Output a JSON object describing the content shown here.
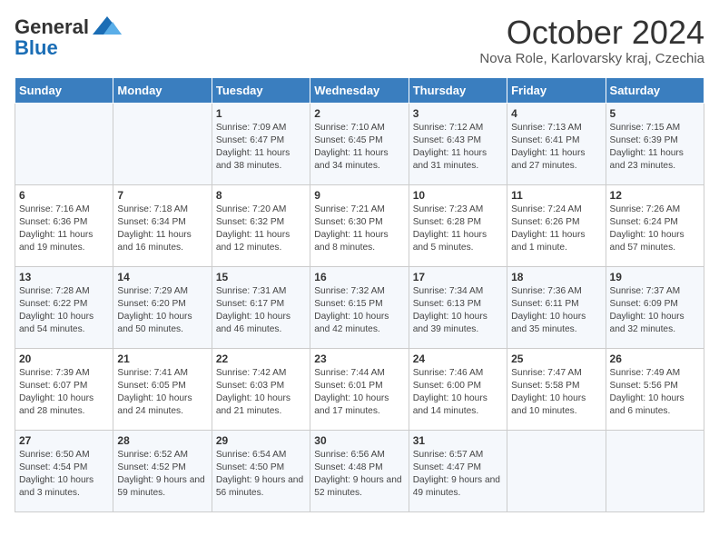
{
  "header": {
    "logo_general": "General",
    "logo_blue": "Blue",
    "month_title": "October 2024",
    "location": "Nova Role, Karlovarsky kraj, Czechia"
  },
  "weekdays": [
    "Sunday",
    "Monday",
    "Tuesday",
    "Wednesday",
    "Thursday",
    "Friday",
    "Saturday"
  ],
  "weeks": [
    [
      {
        "day": "",
        "content": ""
      },
      {
        "day": "",
        "content": ""
      },
      {
        "day": "1",
        "content": "Sunrise: 7:09 AM\nSunset: 6:47 PM\nDaylight: 11 hours and 38 minutes."
      },
      {
        "day": "2",
        "content": "Sunrise: 7:10 AM\nSunset: 6:45 PM\nDaylight: 11 hours and 34 minutes."
      },
      {
        "day": "3",
        "content": "Sunrise: 7:12 AM\nSunset: 6:43 PM\nDaylight: 11 hours and 31 minutes."
      },
      {
        "day": "4",
        "content": "Sunrise: 7:13 AM\nSunset: 6:41 PM\nDaylight: 11 hours and 27 minutes."
      },
      {
        "day": "5",
        "content": "Sunrise: 7:15 AM\nSunset: 6:39 PM\nDaylight: 11 hours and 23 minutes."
      }
    ],
    [
      {
        "day": "6",
        "content": "Sunrise: 7:16 AM\nSunset: 6:36 PM\nDaylight: 11 hours and 19 minutes."
      },
      {
        "day": "7",
        "content": "Sunrise: 7:18 AM\nSunset: 6:34 PM\nDaylight: 11 hours and 16 minutes."
      },
      {
        "day": "8",
        "content": "Sunrise: 7:20 AM\nSunset: 6:32 PM\nDaylight: 11 hours and 12 minutes."
      },
      {
        "day": "9",
        "content": "Sunrise: 7:21 AM\nSunset: 6:30 PM\nDaylight: 11 hours and 8 minutes."
      },
      {
        "day": "10",
        "content": "Sunrise: 7:23 AM\nSunset: 6:28 PM\nDaylight: 11 hours and 5 minutes."
      },
      {
        "day": "11",
        "content": "Sunrise: 7:24 AM\nSunset: 6:26 PM\nDaylight: 11 hours and 1 minute."
      },
      {
        "day": "12",
        "content": "Sunrise: 7:26 AM\nSunset: 6:24 PM\nDaylight: 10 hours and 57 minutes."
      }
    ],
    [
      {
        "day": "13",
        "content": "Sunrise: 7:28 AM\nSunset: 6:22 PM\nDaylight: 10 hours and 54 minutes."
      },
      {
        "day": "14",
        "content": "Sunrise: 7:29 AM\nSunset: 6:20 PM\nDaylight: 10 hours and 50 minutes."
      },
      {
        "day": "15",
        "content": "Sunrise: 7:31 AM\nSunset: 6:17 PM\nDaylight: 10 hours and 46 minutes."
      },
      {
        "day": "16",
        "content": "Sunrise: 7:32 AM\nSunset: 6:15 PM\nDaylight: 10 hours and 42 minutes."
      },
      {
        "day": "17",
        "content": "Sunrise: 7:34 AM\nSunset: 6:13 PM\nDaylight: 10 hours and 39 minutes."
      },
      {
        "day": "18",
        "content": "Sunrise: 7:36 AM\nSunset: 6:11 PM\nDaylight: 10 hours and 35 minutes."
      },
      {
        "day": "19",
        "content": "Sunrise: 7:37 AM\nSunset: 6:09 PM\nDaylight: 10 hours and 32 minutes."
      }
    ],
    [
      {
        "day": "20",
        "content": "Sunrise: 7:39 AM\nSunset: 6:07 PM\nDaylight: 10 hours and 28 minutes."
      },
      {
        "day": "21",
        "content": "Sunrise: 7:41 AM\nSunset: 6:05 PM\nDaylight: 10 hours and 24 minutes."
      },
      {
        "day": "22",
        "content": "Sunrise: 7:42 AM\nSunset: 6:03 PM\nDaylight: 10 hours and 21 minutes."
      },
      {
        "day": "23",
        "content": "Sunrise: 7:44 AM\nSunset: 6:01 PM\nDaylight: 10 hours and 17 minutes."
      },
      {
        "day": "24",
        "content": "Sunrise: 7:46 AM\nSunset: 6:00 PM\nDaylight: 10 hours and 14 minutes."
      },
      {
        "day": "25",
        "content": "Sunrise: 7:47 AM\nSunset: 5:58 PM\nDaylight: 10 hours and 10 minutes."
      },
      {
        "day": "26",
        "content": "Sunrise: 7:49 AM\nSunset: 5:56 PM\nDaylight: 10 hours and 6 minutes."
      }
    ],
    [
      {
        "day": "27",
        "content": "Sunrise: 6:50 AM\nSunset: 4:54 PM\nDaylight: 10 hours and 3 minutes."
      },
      {
        "day": "28",
        "content": "Sunrise: 6:52 AM\nSunset: 4:52 PM\nDaylight: 9 hours and 59 minutes."
      },
      {
        "day": "29",
        "content": "Sunrise: 6:54 AM\nSunset: 4:50 PM\nDaylight: 9 hours and 56 minutes."
      },
      {
        "day": "30",
        "content": "Sunrise: 6:56 AM\nSunset: 4:48 PM\nDaylight: 9 hours and 52 minutes."
      },
      {
        "day": "31",
        "content": "Sunrise: 6:57 AM\nSunset: 4:47 PM\nDaylight: 9 hours and 49 minutes."
      },
      {
        "day": "",
        "content": ""
      },
      {
        "day": "",
        "content": ""
      }
    ]
  ]
}
